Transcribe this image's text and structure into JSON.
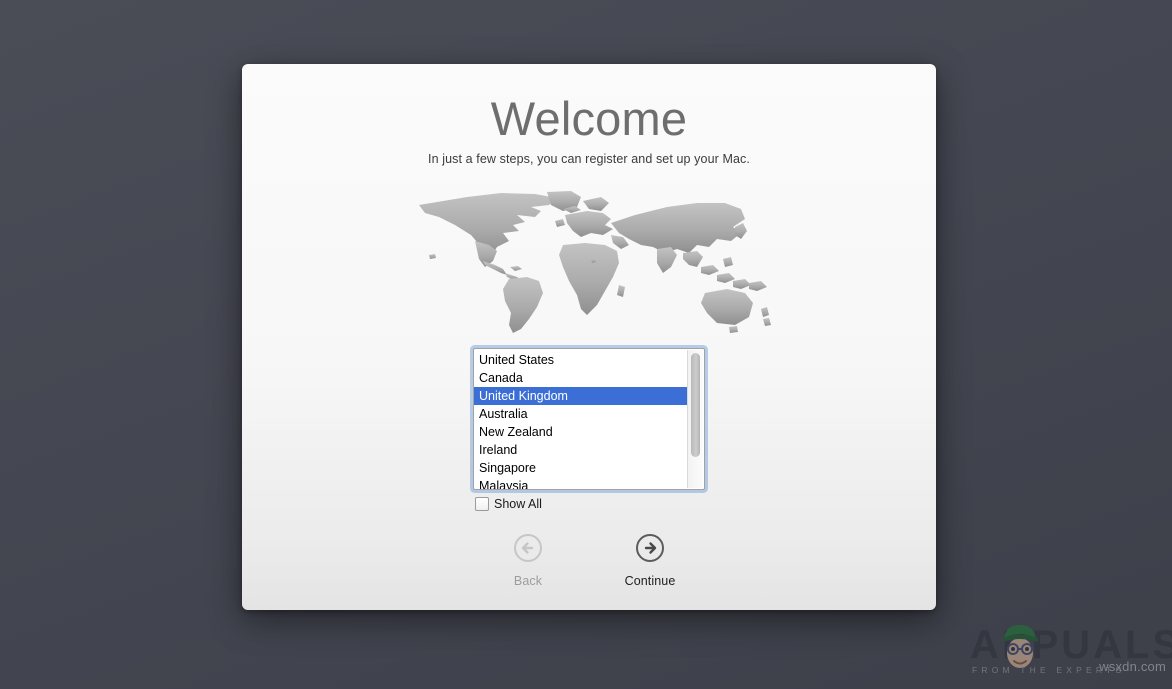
{
  "desktop": {
    "background_color": "#454751"
  },
  "window": {
    "title": "Welcome",
    "subtitle": "In just a few steps, you can register and set up your Mac.",
    "map_icon": "world-map-icon"
  },
  "country_list": {
    "selected": "United Kingdom",
    "options": [
      "United States",
      "Canada",
      "United Kingdom",
      "Australia",
      "New Zealand",
      "Ireland",
      "Singapore",
      "Malaysia"
    ],
    "selection_color": "#3b6fd6",
    "focus_ring_color": "#7daadc"
  },
  "show_all": {
    "label": "Show All",
    "checked": false,
    "icon": "checkbox-icon"
  },
  "navigation": {
    "back": {
      "label": "Back",
      "icon": "arrow-left-circle-icon",
      "enabled": false
    },
    "continue": {
      "label": "Continue",
      "icon": "arrow-right-circle-icon",
      "enabled": true
    }
  },
  "watermark": {
    "brand": "APPUALS",
    "tagline": "FROM THE EXPERTS",
    "domain": "wsxdn.com",
    "mascot": "mascot-icon"
  }
}
